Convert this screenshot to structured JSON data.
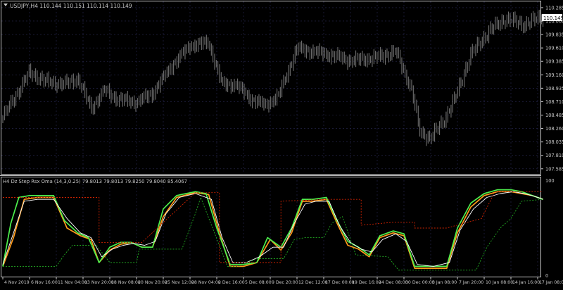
{
  "price_panel": {
    "header": "USDJPY,H4  110.144 110.151 110.114 110.149",
    "current_price_label": "110.149",
    "ticks": [
      110.285,
      110.06,
      109.835,
      109.61,
      109.385,
      109.16,
      108.935,
      108.71,
      108.485,
      108.26,
      108.035,
      107.81,
      107.585
    ]
  },
  "indicator_panel": {
    "header": "H4 Dz Step Rsx Oma (14,3,0.25) 79.8013 79.8013 79.8250 79.8040 85.4067",
    "ticks": [
      "100",
      "0"
    ]
  },
  "x_axis": {
    "labels": [
      "4 Nov 2019",
      "6 Nov 16:00",
      "11 Nov 04:00",
      "13 Nov 20:00",
      "18 Nov 08:00",
      "20 Nov 20:00",
      "25 Nov 12:00",
      "28 Nov 04:00",
      "2 Dec 16:00",
      "5 Dec 08:00",
      "9 Dec 20:00",
      "12 Dec 12:00",
      "17 Dec 00:00",
      "19 Dec 16:00",
      "24 Dec 08:00",
      "30 Dec 00:00",
      "3 Jan 08:00",
      "7 Jan 20:00",
      "10 Jan 08:00",
      "14 Jan 16:00",
      "17 Jan 08:00"
    ]
  },
  "colors": {
    "background": "#000000",
    "axis_text": "#c8c8c8",
    "candles": "#7a7a7a",
    "grid": "#2b2b55",
    "rsx_fast": "#ff9a1a",
    "rsx_slow": "#4df04d",
    "rsx_signal": "#ffffff",
    "upper_level": "#cc2200",
    "lower_level": "#22aa22",
    "price_tag_bg": "#ffffff",
    "price_tag_text": "#000000"
  },
  "chart_data": [
    {
      "type": "candlestick",
      "title": "USDJPY,H4",
      "ohlc_readout": {
        "open": 110.144,
        "high": 110.151,
        "low": 110.114,
        "close": 110.149
      },
      "ylim": [
        107.5,
        110.39
      ],
      "x_categories": [
        "4 Nov 2019",
        "6 Nov 16:00",
        "11 Nov 04:00",
        "13 Nov 20:00",
        "18 Nov 08:00",
        "20 Nov 20:00",
        "25 Nov 12:00",
        "28 Nov 04:00",
        "2 Dec 16:00",
        "5 Dec 08:00",
        "9 Dec 20:00",
        "12 Dec 12:00",
        "17 Dec 00:00",
        "19 Dec 16:00",
        "24 Dec 08:00",
        "30 Dec 00:00",
        "3 Jan 08:00",
        "7 Jan 20:00",
        "10 Jan 08:00",
        "14 Jan 16:00",
        "17 Jan 08:00"
      ],
      "close_path": [
        [
          0,
          108.45
        ],
        [
          1,
          109.2
        ],
        [
          1.6,
          109.05
        ],
        [
          2.3,
          109.0
        ],
        [
          2.8,
          109.1
        ],
        [
          3.3,
          108.6
        ],
        [
          3.8,
          108.9
        ],
        [
          4.3,
          108.75
        ],
        [
          5.0,
          108.7
        ],
        [
          5.6,
          108.85
        ],
        [
          6.3,
          109.3
        ],
        [
          7.0,
          109.65
        ],
        [
          7.7,
          109.7
        ],
        [
          8.2,
          109.0
        ],
        [
          8.7,
          109.0
        ],
        [
          9.3,
          108.75
        ],
        [
          9.8,
          108.65
        ],
        [
          10.3,
          108.8
        ],
        [
          11.0,
          109.6
        ],
        [
          11.6,
          109.55
        ],
        [
          12.2,
          109.5
        ],
        [
          13.0,
          109.4
        ],
        [
          14.0,
          109.45
        ],
        [
          14.7,
          109.55
        ],
        [
          15.3,
          108.9
        ],
        [
          15.6,
          108.2
        ],
        [
          16.0,
          108.1
        ],
        [
          16.5,
          108.4
        ],
        [
          16.9,
          108.75
        ],
        [
          17.5,
          109.5
        ],
        [
          18.2,
          109.9
        ],
        [
          18.8,
          110.1
        ],
        [
          19.5,
          110.0
        ],
        [
          20.2,
          110.149
        ]
      ]
    },
    {
      "type": "line",
      "title": "H4 Dz Step Rsx Oma (14,3,0.25)",
      "readout_values": [
        79.8013,
        79.8013,
        79.825,
        79.804,
        85.4067
      ],
      "ylim": [
        0,
        100
      ],
      "x_categories": [
        "4 Nov 2019",
        "6 Nov 16:00",
        "11 Nov 04:00",
        "13 Nov 20:00",
        "18 Nov 08:00",
        "20 Nov 20:00",
        "25 Nov 12:00",
        "28 Nov 04:00",
        "2 Dec 16:00",
        "5 Dec 08:00",
        "9 Dec 20:00",
        "12 Dec 12:00",
        "17 Dec 00:00",
        "19 Dec 16:00",
        "24 Dec 08:00",
        "30 Dec 00:00",
        "3 Jan 08:00",
        "7 Jan 20:00",
        "10 Jan 08:00",
        "14 Jan 16:00",
        "17 Jan 08:00"
      ],
      "series": [
        {
          "color": "#ff9a1a",
          "points": [
            [
              0,
              10
            ],
            [
              0.4,
              40
            ],
            [
              0.8,
              80
            ],
            [
              1.3,
              82
            ],
            [
              1.9,
              82
            ],
            [
              2.4,
              50
            ],
            [
              2.9,
              42
            ],
            [
              3.3,
              38
            ],
            [
              3.6,
              14
            ],
            [
              4.0,
              27
            ],
            [
              4.4,
              33
            ],
            [
              4.8,
              35
            ],
            [
              5.2,
              30
            ],
            [
              5.6,
              30
            ],
            [
              6.0,
              62
            ],
            [
              6.5,
              82
            ],
            [
              7.2,
              87
            ],
            [
              7.7,
              85
            ],
            [
              8.1,
              45
            ],
            [
              8.5,
              10
            ],
            [
              9.0,
              10
            ],
            [
              9.5,
              14
            ],
            [
              10.0,
              38
            ],
            [
              10.4,
              27
            ],
            [
              10.8,
              45
            ],
            [
              11.2,
              78
            ],
            [
              11.6,
              78
            ],
            [
              12.1,
              80
            ],
            [
              12.5,
              55
            ],
            [
              12.9,
              32
            ],
            [
              13.3,
              28
            ],
            [
              13.7,
              20
            ],
            [
              14.1,
              40
            ],
            [
              14.6,
              45
            ],
            [
              15.0,
              42
            ],
            [
              15.4,
              8
            ],
            [
              16.0,
              8
            ],
            [
              16.6,
              8
            ],
            [
              17.0,
              45
            ],
            [
              17.5,
              72
            ],
            [
              18.0,
              84
            ],
            [
              18.5,
              88
            ],
            [
              19.0,
              88
            ],
            [
              19.4,
              86
            ],
            [
              19.8,
              84
            ],
            [
              20.2,
              80
            ]
          ]
        },
        {
          "color": "#4df04d",
          "points": [
            [
              0,
              10
            ],
            [
              0.3,
              55
            ],
            [
              0.6,
              82
            ],
            [
              1.0,
              84
            ],
            [
              1.9,
              84
            ],
            [
              2.3,
              58
            ],
            [
              2.8,
              45
            ],
            [
              3.2,
              40
            ],
            [
              3.6,
              14
            ],
            [
              4.0,
              30
            ],
            [
              4.4,
              35
            ],
            [
              4.8,
              35
            ],
            [
              5.2,
              30
            ],
            [
              5.6,
              30
            ],
            [
              6.0,
              70
            ],
            [
              6.5,
              84
            ],
            [
              7.2,
              88
            ],
            [
              7.6,
              86
            ],
            [
              8.0,
              50
            ],
            [
              8.5,
              12
            ],
            [
              9.0,
              12
            ],
            [
              9.5,
              14
            ],
            [
              9.9,
              40
            ],
            [
              10.4,
              30
            ],
            [
              10.8,
              50
            ],
            [
              11.2,
              80
            ],
            [
              11.6,
              80
            ],
            [
              12.1,
              82
            ],
            [
              12.5,
              58
            ],
            [
              12.9,
              36
            ],
            [
              13.3,
              30
            ],
            [
              13.7,
              22
            ],
            [
              14.1,
              42
            ],
            [
              14.6,
              47
            ],
            [
              15.0,
              44
            ],
            [
              15.4,
              10
            ],
            [
              16.0,
              10
            ],
            [
              16.6,
              10
            ],
            [
              17.0,
              50
            ],
            [
              17.5,
              76
            ],
            [
              18.0,
              86
            ],
            [
              18.5,
              90
            ],
            [
              19.0,
              90
            ],
            [
              19.4,
              88
            ],
            [
              19.8,
              84
            ],
            [
              20.2,
              80
            ]
          ]
        },
        {
          "color": "#ffffff",
          "points": [
            [
              0,
              12
            ],
            [
              0.4,
              45
            ],
            [
              0.8,
              78
            ],
            [
              1.3,
              80
            ],
            [
              1.9,
              80
            ],
            [
              2.4,
              60
            ],
            [
              2.9,
              45
            ],
            [
              3.3,
              40
            ],
            [
              3.7,
              20
            ],
            [
              4.1,
              28
            ],
            [
              4.5,
              32
            ],
            [
              4.9,
              34
            ],
            [
              5.3,
              32
            ],
            [
              5.7,
              36
            ],
            [
              6.1,
              65
            ],
            [
              6.6,
              82
            ],
            [
              7.2,
              86
            ],
            [
              7.8,
              80
            ],
            [
              8.2,
              40
            ],
            [
              8.6,
              14
            ],
            [
              9.1,
              14
            ],
            [
              9.6,
              20
            ],
            [
              10.1,
              30
            ],
            [
              10.5,
              30
            ],
            [
              10.9,
              55
            ],
            [
              11.3,
              75
            ],
            [
              11.7,
              78
            ],
            [
              12.2,
              78
            ],
            [
              12.6,
              52
            ],
            [
              13.0,
              35
            ],
            [
              13.4,
              28
            ],
            [
              13.8,
              25
            ],
            [
              14.2,
              38
            ],
            [
              14.7,
              44
            ],
            [
              15.1,
              36
            ],
            [
              15.5,
              12
            ],
            [
              16.1,
              10
            ],
            [
              16.7,
              14
            ],
            [
              17.1,
              48
            ],
            [
              17.6,
              70
            ],
            [
              18.1,
              82
            ],
            [
              18.6,
              86
            ],
            [
              19.1,
              88
            ],
            [
              19.5,
              86
            ],
            [
              19.9,
              83
            ],
            [
              20.2,
              80
            ]
          ]
        },
        {
          "color": "#cc2200",
          "points": [
            [
              0,
              82
            ],
            [
              1.9,
              82
            ],
            [
              1.9,
              82
            ],
            [
              3.6,
              82
            ],
            [
              3.6,
              35
            ],
            [
              5.2,
              35
            ],
            [
              5.2,
              35
            ],
            [
              7.2,
              87
            ],
            [
              8.1,
              87
            ],
            [
              8.1,
              14
            ],
            [
              10.4,
              14
            ],
            [
              10.4,
              78
            ],
            [
              12.1,
              80
            ],
            [
              13.4,
              80
            ],
            [
              13.4,
              53
            ],
            [
              14.6,
              56
            ],
            [
              15.4,
              56
            ],
            [
              15.4,
              50
            ],
            [
              16.6,
              50
            ],
            [
              16.6,
              50
            ],
            [
              17.9,
              60
            ],
            [
              18.4,
              88
            ],
            [
              20.2,
              88
            ]
          ]
        },
        {
          "color": "#22aa22",
          "points": [
            [
              0,
              10
            ],
            [
              2.0,
              10
            ],
            [
              2.3,
              22
            ],
            [
              2.6,
              32
            ],
            [
              3.5,
              32
            ],
            [
              4.0,
              14
            ],
            [
              5.0,
              14
            ],
            [
              5.1,
              28
            ],
            [
              6.7,
              28
            ],
            [
              7.2,
              65
            ],
            [
              7.4,
              82
            ],
            [
              8.4,
              10
            ],
            [
              8.8,
              10
            ],
            [
              9.5,
              18
            ],
            [
              10.5,
              18
            ],
            [
              10.9,
              38
            ],
            [
              11.3,
              40
            ],
            [
              12.0,
              40
            ],
            [
              12.3,
              55
            ],
            [
              12.7,
              62
            ],
            [
              13.2,
              22
            ],
            [
              14.4,
              20
            ],
            [
              14.8,
              6
            ],
            [
              17.7,
              6
            ],
            [
              18.1,
              30
            ],
            [
              18.6,
              50
            ],
            [
              19.0,
              60
            ],
            [
              19.4,
              78
            ],
            [
              20.2,
              80
            ]
          ]
        }
      ]
    }
  ]
}
